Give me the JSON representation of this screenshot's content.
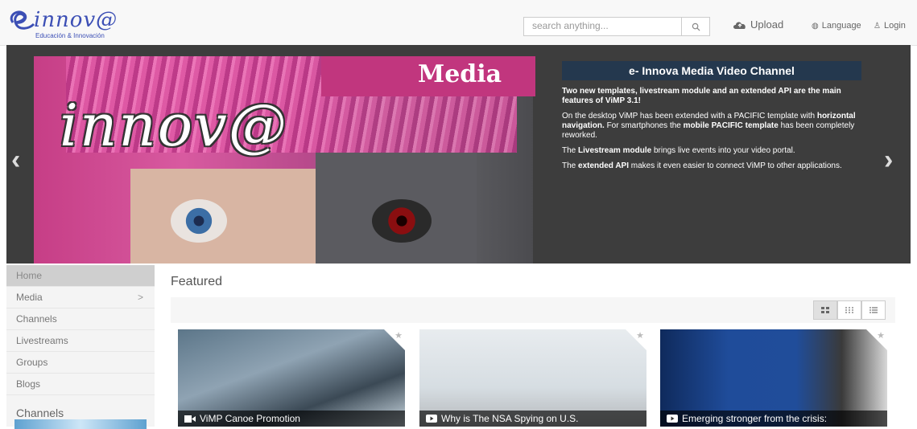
{
  "header": {
    "logo_text": "innov@",
    "logo_subtext": "Educación & Innovación",
    "search_placeholder": "search anything...",
    "upload_label": "Upload",
    "language_label": "Language",
    "login_label": "Login"
  },
  "hero": {
    "brand_text": "innov@",
    "banner_text": "Media",
    "title": "e- Innova Media Video Channel",
    "p1": "Two new templates, livestream module and an extended API are the main features of ViMP 3.1!",
    "p2a": "On the desktop ViMP has been extended with a PACIFIC template with ",
    "p2b": "horizontal navigation.",
    "p2c": " For smartphones the ",
    "p2d": "mobile PACIFIC template",
    "p2e": " has been completely reworked.",
    "p3a": "The ",
    "p3b": "Livestream module",
    "p3c": " brings live events into your video portal.",
    "p4a": "The ",
    "p4b": "extended API",
    "p4c": " makes it even easier to connect ViMP to other applications."
  },
  "sidebar": {
    "items": [
      {
        "label": "Home"
      },
      {
        "label": "Media"
      },
      {
        "label": "Channels"
      },
      {
        "label": "Livestreams"
      },
      {
        "label": "Groups"
      },
      {
        "label": "Blogs"
      }
    ],
    "channels_heading": "Channels"
  },
  "main": {
    "featured_title": "Featured",
    "cards": [
      {
        "caption": "ViMP Canoe Promotion"
      },
      {
        "caption": "Why is The NSA Spying on U.S."
      },
      {
        "caption": "Emerging stronger from the crisis:"
      }
    ]
  },
  "colors": {
    "accent": "#c1367e",
    "hero_title_bg": "#24384e",
    "logo": "#3c4fb5"
  }
}
